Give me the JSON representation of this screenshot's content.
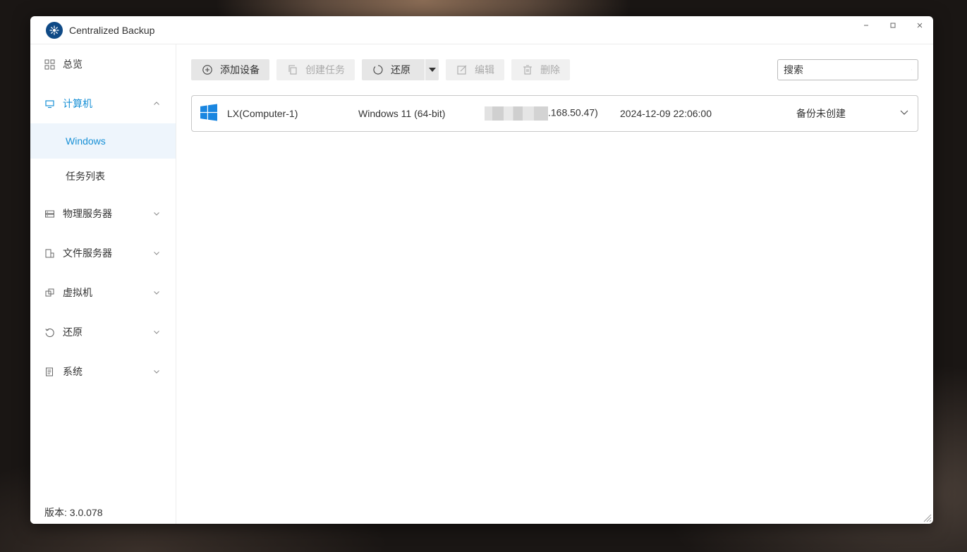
{
  "window": {
    "title": "Centralized Backup",
    "controls": {
      "minimize": "–",
      "maximize": "□",
      "close": "✕"
    }
  },
  "sidebar": {
    "items": [
      {
        "label": "总览",
        "icon": "grid-icon"
      },
      {
        "label": "计算机",
        "icon": "monitor-icon",
        "expanded": true,
        "children": [
          {
            "label": "Windows",
            "selected": true
          },
          {
            "label": "任务列表"
          }
        ]
      },
      {
        "label": "物理服务器",
        "icon": "server-icon"
      },
      {
        "label": "文件服务器",
        "icon": "file-server-icon"
      },
      {
        "label": "虚拟机",
        "icon": "virtual-machine-icon"
      },
      {
        "label": "还原",
        "icon": "restore-icon"
      },
      {
        "label": "系统",
        "icon": "system-icon"
      }
    ],
    "version": "版本: 3.0.078"
  },
  "toolbar": {
    "add_device": "添加设备",
    "create_task": "创建任务",
    "restore": "还原",
    "edit": "编辑",
    "delete": "删除",
    "search_placeholder": "搜索"
  },
  "devices": [
    {
      "name": "LX(Computer-1)",
      "os": "Windows 11 (64-bit)",
      "ip_visible": ".168.50.47)",
      "time": "2024-12-09 22:06:00",
      "status": "备份未创建"
    }
  ],
  "colors": {
    "accent": "#1890d6",
    "windows_logo": "#1a86e0",
    "logo_bg": "#0f4a86"
  }
}
